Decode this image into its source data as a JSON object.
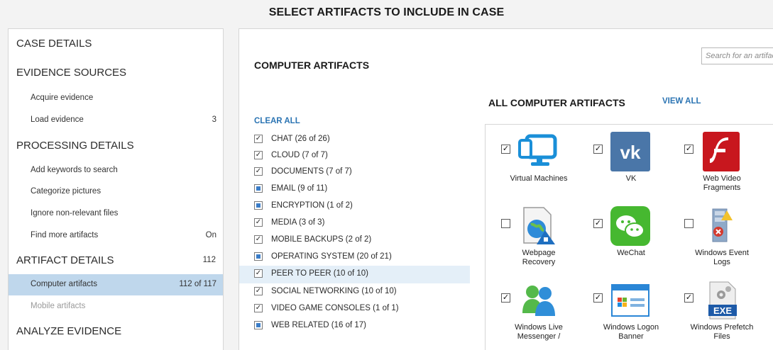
{
  "page_title": "SELECT ARTIFACTS TO INCLUDE IN CASE",
  "sidebar": {
    "case_details": "CASE DETAILS",
    "evidence_sources": {
      "title": "EVIDENCE SOURCES",
      "items": [
        {
          "label": "Acquire evidence",
          "value": ""
        },
        {
          "label": "Load evidence",
          "value": "3"
        }
      ]
    },
    "processing_details": {
      "title": "PROCESSING DETAILS",
      "items": [
        {
          "label": "Add keywords to search",
          "value": ""
        },
        {
          "label": "Categorize pictures",
          "value": ""
        },
        {
          "label": "Ignore non-relevant files",
          "value": ""
        },
        {
          "label": "Find more artifacts",
          "value": "On"
        }
      ]
    },
    "artifact_details": {
      "title": "ARTIFACT DETAILS",
      "count": "112",
      "items": [
        {
          "label": "Computer artifacts",
          "value": "112 of 117",
          "selected": true
        },
        {
          "label": "Mobile artifacts",
          "value": "",
          "disabled": true
        }
      ]
    },
    "analyze_evidence": "ANALYZE EVIDENCE"
  },
  "main": {
    "section_title": "COMPUTER ARTIFACTS",
    "search_placeholder": "Search for an artifact",
    "clear_all": "CLEAR ALL",
    "all_title": "ALL COMPUTER ARTIFACTS",
    "view_all": "VIEW ALL",
    "categories": [
      {
        "label": "CHAT  (26 of 26)",
        "state": "checked"
      },
      {
        "label": "CLOUD  (7 of 7)",
        "state": "checked"
      },
      {
        "label": "DOCUMENTS  (7 of 7)",
        "state": "checked"
      },
      {
        "label": "EMAIL  (9 of 11)",
        "state": "partial"
      },
      {
        "label": "ENCRYPTION  (1 of 2)",
        "state": "partial"
      },
      {
        "label": "MEDIA  (3 of 3)",
        "state": "checked"
      },
      {
        "label": "MOBILE BACKUPS  (2 of 2)",
        "state": "checked"
      },
      {
        "label": "OPERATING SYSTEM  (20 of 21)",
        "state": "partial"
      },
      {
        "label": "PEER TO PEER  (10 of 10)",
        "state": "checked",
        "highlight": true
      },
      {
        "label": "SOCIAL NETWORKING  (10 of 10)",
        "state": "checked"
      },
      {
        "label": "VIDEO GAME CONSOLES  (1 of 1)",
        "state": "checked"
      },
      {
        "label": "WEB RELATED  (16 of 17)",
        "state": "partial"
      }
    ],
    "artifacts": [
      {
        "label": "Virtual Machines",
        "checked": true,
        "icon": "monitor-icon"
      },
      {
        "label": "VK",
        "checked": true,
        "icon": "vk-icon"
      },
      {
        "label": "Web Video Fragments",
        "checked": true,
        "icon": "flash-icon"
      },
      {
        "label": "Webpage Recovery",
        "checked": false,
        "icon": "webpage-recovery-icon"
      },
      {
        "label": "WeChat",
        "checked": true,
        "icon": "wechat-icon"
      },
      {
        "label": "Windows Event Logs",
        "checked": false,
        "icon": "event-log-icon"
      },
      {
        "label": "Windows Live Messenger /",
        "checked": true,
        "icon": "messenger-icon"
      },
      {
        "label": "Windows Logon Banner",
        "checked": true,
        "icon": "logon-banner-icon"
      },
      {
        "label": "Windows Prefetch Files",
        "checked": true,
        "icon": "exe-icon"
      }
    ]
  },
  "colors": {
    "link": "#2b74b3",
    "selected_bg": "#bfd7ec",
    "highlight_bg": "#e4eff8",
    "partial_fill": "#3b7dc8"
  }
}
